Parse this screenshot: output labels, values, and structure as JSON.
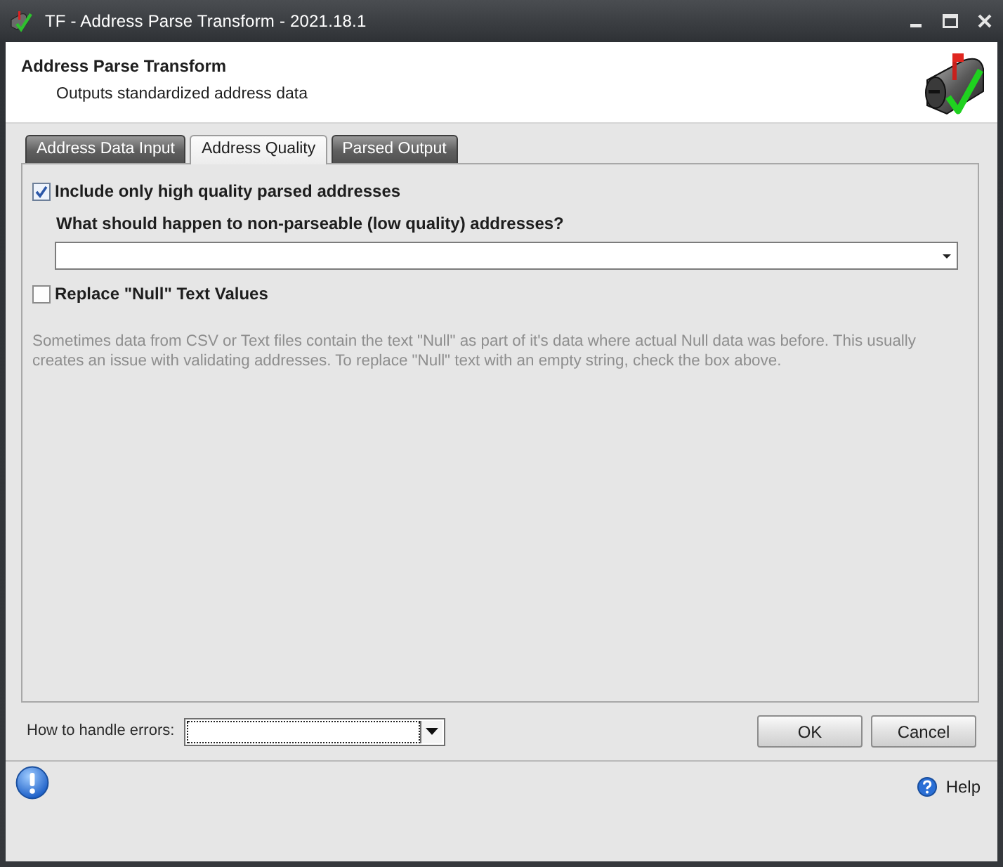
{
  "window": {
    "title": "TF - Address Parse Transform - 2021.18.1"
  },
  "header": {
    "title": "Address Parse Transform",
    "subtitle": "Outputs standardized address data"
  },
  "tabs": [
    {
      "label": "Address Data Input",
      "selected": false
    },
    {
      "label": "Address Quality",
      "selected": true
    },
    {
      "label": "Parsed Output",
      "selected": false
    }
  ],
  "panel": {
    "high_quality_only": {
      "label": "Include only high quality parsed addresses",
      "checked": true
    },
    "low_quality_question": "What should happen to non-parseable (low quality) addresses?",
    "replace_null": {
      "label": "Replace \"Null\" Text Values",
      "checked": false
    },
    "note": "Sometimes data from CSV or Text files contain the text \"Null\" as part of it's data where actual Null data was before. This usually creates an issue with validating addresses. To replace \"Null\" text with an empty string, check the box above."
  },
  "footer": {
    "errors_label": "How to handle errors:",
    "buttons": [
      "OK",
      "Cancel"
    ]
  },
  "status_bar": {
    "help": "Help"
  }
}
